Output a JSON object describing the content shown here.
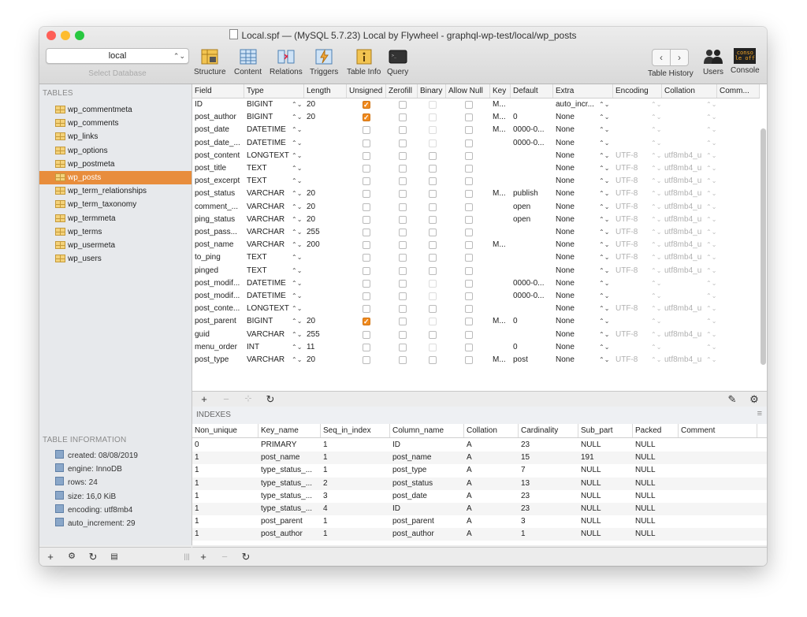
{
  "window": {
    "title": "Local.spf — (MySQL 5.7.23) Local by Flywheel - graphql-wp-test/local/wp_posts",
    "traffic_lights": [
      "#fe5f57",
      "#febc2e",
      "#28c840"
    ]
  },
  "database": {
    "selected": "local",
    "placeholder": "Select Database"
  },
  "toolbar": {
    "buttons": [
      {
        "label": "Structure",
        "icon": "structure-icon"
      },
      {
        "label": "Content",
        "icon": "content-icon"
      },
      {
        "label": "Relations",
        "icon": "relations-icon"
      },
      {
        "label": "Triggers",
        "icon": "triggers-icon"
      },
      {
        "label": "Table Info",
        "icon": "table-info-icon"
      },
      {
        "label": "Query",
        "icon": "query-icon"
      }
    ],
    "table_history_label": "Table History",
    "users_label": "Users",
    "console_label": "Console",
    "console_icon_text": "conso le off"
  },
  "sidebar": {
    "tables_header": "TABLES",
    "tables": [
      "wp_commentmeta",
      "wp_comments",
      "wp_links",
      "wp_options",
      "wp_postmeta",
      "wp_posts",
      "wp_term_relationships",
      "wp_term_taxonomy",
      "wp_termmeta",
      "wp_terms",
      "wp_usermeta",
      "wp_users"
    ],
    "selected_index": 5,
    "info_header": "TABLE INFORMATION",
    "info": [
      "created: 08/08/2019",
      "engine: InnoDB",
      "rows: 24",
      "size: 16,0 KiB",
      "encoding: utf8mb4",
      "auto_increment: 29"
    ]
  },
  "fields_header": [
    "Field",
    "Type",
    "Length",
    "Unsigned",
    "Zerofill",
    "Binary",
    "Allow Null",
    "Key",
    "Default",
    "Extra",
    "Encoding",
    "Collation",
    "Comm..."
  ],
  "fields": [
    {
      "field": "ID",
      "type": "BIGINT",
      "length": "20",
      "unsigned": true,
      "binary_en": false,
      "key": "M...",
      "default": "",
      "extra": "auto_incr...",
      "encoding": "",
      "collation": ""
    },
    {
      "field": "post_author",
      "type": "BIGINT",
      "length": "20",
      "unsigned": true,
      "binary_en": false,
      "key": "M...",
      "default": "0",
      "extra": "None",
      "encoding": "",
      "collation": ""
    },
    {
      "field": "post_date",
      "type": "DATETIME",
      "length": "",
      "unsigned": false,
      "binary_en": false,
      "key": "M...",
      "default": "0000-0...",
      "extra": "None",
      "encoding": "",
      "collation": ""
    },
    {
      "field": "post_date_...",
      "type": "DATETIME",
      "length": "",
      "unsigned": false,
      "binary_en": false,
      "key": "",
      "default": "0000-0...",
      "extra": "None",
      "encoding": "",
      "collation": ""
    },
    {
      "field": "post_content",
      "type": "LONGTEXT",
      "length": "",
      "unsigned": false,
      "binary_en": true,
      "key": "",
      "default": "",
      "extra": "None",
      "encoding": "UTF-8",
      "collation": "utf8mb4_u"
    },
    {
      "field": "post_title",
      "type": "TEXT",
      "length": "",
      "unsigned": false,
      "binary_en": true,
      "key": "",
      "default": "",
      "extra": "None",
      "encoding": "UTF-8",
      "collation": "utf8mb4_u"
    },
    {
      "field": "post_excerpt",
      "type": "TEXT",
      "length": "",
      "unsigned": false,
      "binary_en": true,
      "key": "",
      "default": "",
      "extra": "None",
      "encoding": "UTF-8",
      "collation": "utf8mb4_u"
    },
    {
      "field": "post_status",
      "type": "VARCHAR",
      "length": "20",
      "unsigned": false,
      "binary_en": true,
      "key": "M...",
      "default": "publish",
      "extra": "None",
      "encoding": "UTF-8",
      "collation": "utf8mb4_u"
    },
    {
      "field": "comment_...",
      "type": "VARCHAR",
      "length": "20",
      "unsigned": false,
      "binary_en": true,
      "key": "",
      "default": "open",
      "extra": "None",
      "encoding": "UTF-8",
      "collation": "utf8mb4_u"
    },
    {
      "field": "ping_status",
      "type": "VARCHAR",
      "length": "20",
      "unsigned": false,
      "binary_en": true,
      "key": "",
      "default": "open",
      "extra": "None",
      "encoding": "UTF-8",
      "collation": "utf8mb4_u"
    },
    {
      "field": "post_pass...",
      "type": "VARCHAR",
      "length": "255",
      "unsigned": false,
      "binary_en": true,
      "key": "",
      "default": "",
      "extra": "None",
      "encoding": "UTF-8",
      "collation": "utf8mb4_u"
    },
    {
      "field": "post_name",
      "type": "VARCHAR",
      "length": "200",
      "unsigned": false,
      "binary_en": true,
      "key": "M...",
      "default": "",
      "extra": "None",
      "encoding": "UTF-8",
      "collation": "utf8mb4_u"
    },
    {
      "field": "to_ping",
      "type": "TEXT",
      "length": "",
      "unsigned": false,
      "binary_en": true,
      "key": "",
      "default": "",
      "extra": "None",
      "encoding": "UTF-8",
      "collation": "utf8mb4_u"
    },
    {
      "field": "pinged",
      "type": "TEXT",
      "length": "",
      "unsigned": false,
      "binary_en": true,
      "key": "",
      "default": "",
      "extra": "None",
      "encoding": "UTF-8",
      "collation": "utf8mb4_u"
    },
    {
      "field": "post_modif...",
      "type": "DATETIME",
      "length": "",
      "unsigned": false,
      "binary_en": false,
      "key": "",
      "default": "0000-0...",
      "extra": "None",
      "encoding": "",
      "collation": ""
    },
    {
      "field": "post_modif...",
      "type": "DATETIME",
      "length": "",
      "unsigned": false,
      "binary_en": false,
      "key": "",
      "default": "0000-0...",
      "extra": "None",
      "encoding": "",
      "collation": ""
    },
    {
      "field": "post_conte...",
      "type": "LONGTEXT",
      "length": "",
      "unsigned": false,
      "binary_en": true,
      "key": "",
      "default": "",
      "extra": "None",
      "encoding": "UTF-8",
      "collation": "utf8mb4_u"
    },
    {
      "field": "post_parent",
      "type": "BIGINT",
      "length": "20",
      "unsigned": true,
      "binary_en": false,
      "key": "M...",
      "default": "0",
      "extra": "None",
      "encoding": "",
      "collation": ""
    },
    {
      "field": "guid",
      "type": "VARCHAR",
      "length": "255",
      "unsigned": false,
      "binary_en": true,
      "key": "",
      "default": "",
      "extra": "None",
      "encoding": "UTF-8",
      "collation": "utf8mb4_u"
    },
    {
      "field": "menu_order",
      "type": "INT",
      "length": "11",
      "unsigned": false,
      "binary_en": false,
      "key": "",
      "default": "0",
      "extra": "None",
      "encoding": "",
      "collation": ""
    },
    {
      "field": "post_type",
      "type": "VARCHAR",
      "length": "20",
      "unsigned": false,
      "binary_en": true,
      "key": "M...",
      "default": "post",
      "extra": "None",
      "encoding": "UTF-8",
      "collation": "utf8mb4_u"
    }
  ],
  "indexes": {
    "title": "INDEXES",
    "header": [
      "Non_unique",
      "Key_name",
      "Seq_in_index",
      "Column_name",
      "Collation",
      "Cardinality",
      "Sub_part",
      "Packed",
      "Comment"
    ],
    "rows": [
      [
        "0",
        "PRIMARY",
        "1",
        "ID",
        "A",
        "23",
        "NULL",
        "NULL",
        ""
      ],
      [
        "1",
        "post_name",
        "1",
        "post_name",
        "A",
        "15",
        "191",
        "NULL",
        ""
      ],
      [
        "1",
        "type_status_...",
        "1",
        "post_type",
        "A",
        "7",
        "NULL",
        "NULL",
        ""
      ],
      [
        "1",
        "type_status_...",
        "2",
        "post_status",
        "A",
        "13",
        "NULL",
        "NULL",
        ""
      ],
      [
        "1",
        "type_status_...",
        "3",
        "post_date",
        "A",
        "23",
        "NULL",
        "NULL",
        ""
      ],
      [
        "1",
        "type_status_...",
        "4",
        "ID",
        "A",
        "23",
        "NULL",
        "NULL",
        ""
      ],
      [
        "1",
        "post_parent",
        "1",
        "post_parent",
        "A",
        "3",
        "NULL",
        "NULL",
        ""
      ],
      [
        "1",
        "post_author",
        "1",
        "post_author",
        "A",
        "1",
        "NULL",
        "NULL",
        ""
      ]
    ]
  },
  "colors": {
    "selection": "#e88d3c",
    "checkbox_on": "#f08a1e"
  }
}
